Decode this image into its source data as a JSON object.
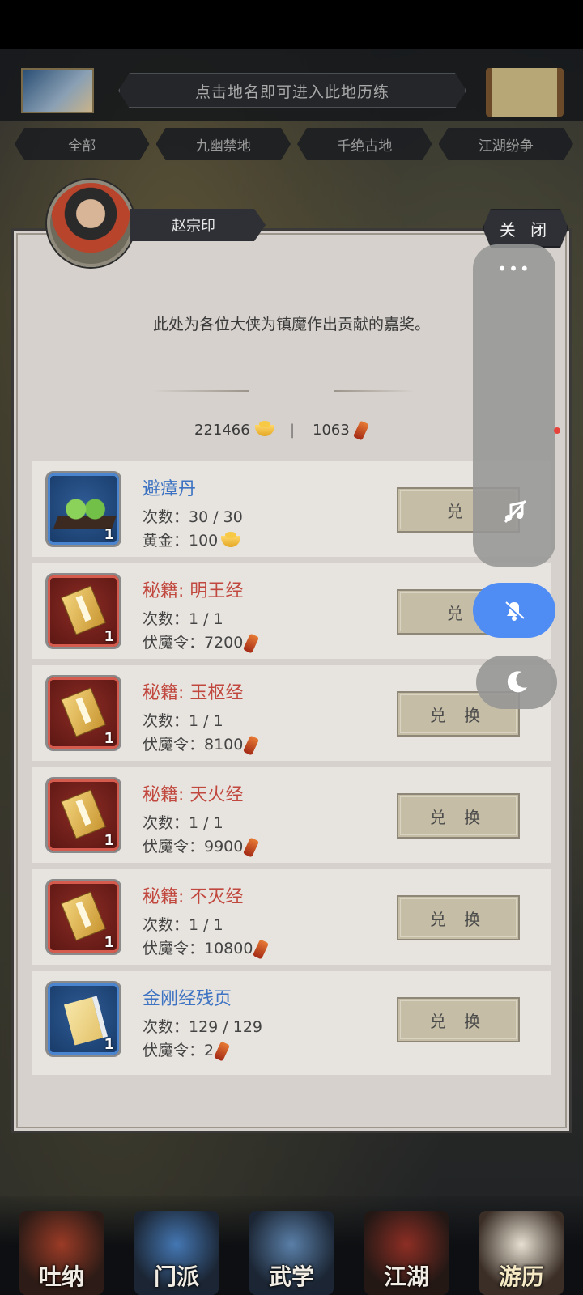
{
  "header": {
    "hint": "点击地名即可进入此地历练",
    "tabs": [
      "全部",
      "九幽禁地",
      "千绝古地",
      "江湖纷争"
    ]
  },
  "npc": {
    "name": "赵宗印"
  },
  "close_label": "关 闭",
  "description": "此处为各位大侠为镇魔作出贡献的嘉奖。",
  "currency": {
    "gold": "221466",
    "token": "1063"
  },
  "items": [
    {
      "name": "避瘴丹",
      "count_label": "次数：30 / 30",
      "cost_label": "黄金：100",
      "qty": "1",
      "button": "兑"
    },
    {
      "name": "秘籍: 明王经",
      "count_label": "次数：1 / 1",
      "cost_label": "伏魔令：7200",
      "qty": "1",
      "button": "兑"
    },
    {
      "name": "秘籍: 玉枢经",
      "count_label": "次数：1 / 1",
      "cost_label": "伏魔令：8100",
      "qty": "1",
      "button": "兑 换"
    },
    {
      "name": "秘籍: 天火经",
      "count_label": "次数：1 / 1",
      "cost_label": "伏魔令：9900",
      "qty": "1",
      "button": "兑 换"
    },
    {
      "name": "秘籍: 不灭经",
      "count_label": "次数：1 / 1",
      "cost_label": "伏魔令：10800",
      "qty": "1",
      "button": "兑 换"
    },
    {
      "name": "金刚经残页",
      "count_label": "次数：129 / 129",
      "cost_label": "伏魔令：2",
      "qty": "1",
      "button": "兑 换"
    }
  ],
  "floating": {
    "dots": "•••"
  },
  "nav": [
    "吐纳",
    "门派",
    "武学",
    "江湖",
    "游历"
  ],
  "colors": {
    "accent_blue": "#4f8df5",
    "item_blue": "#3d73c2",
    "item_red": "#c1483e"
  }
}
